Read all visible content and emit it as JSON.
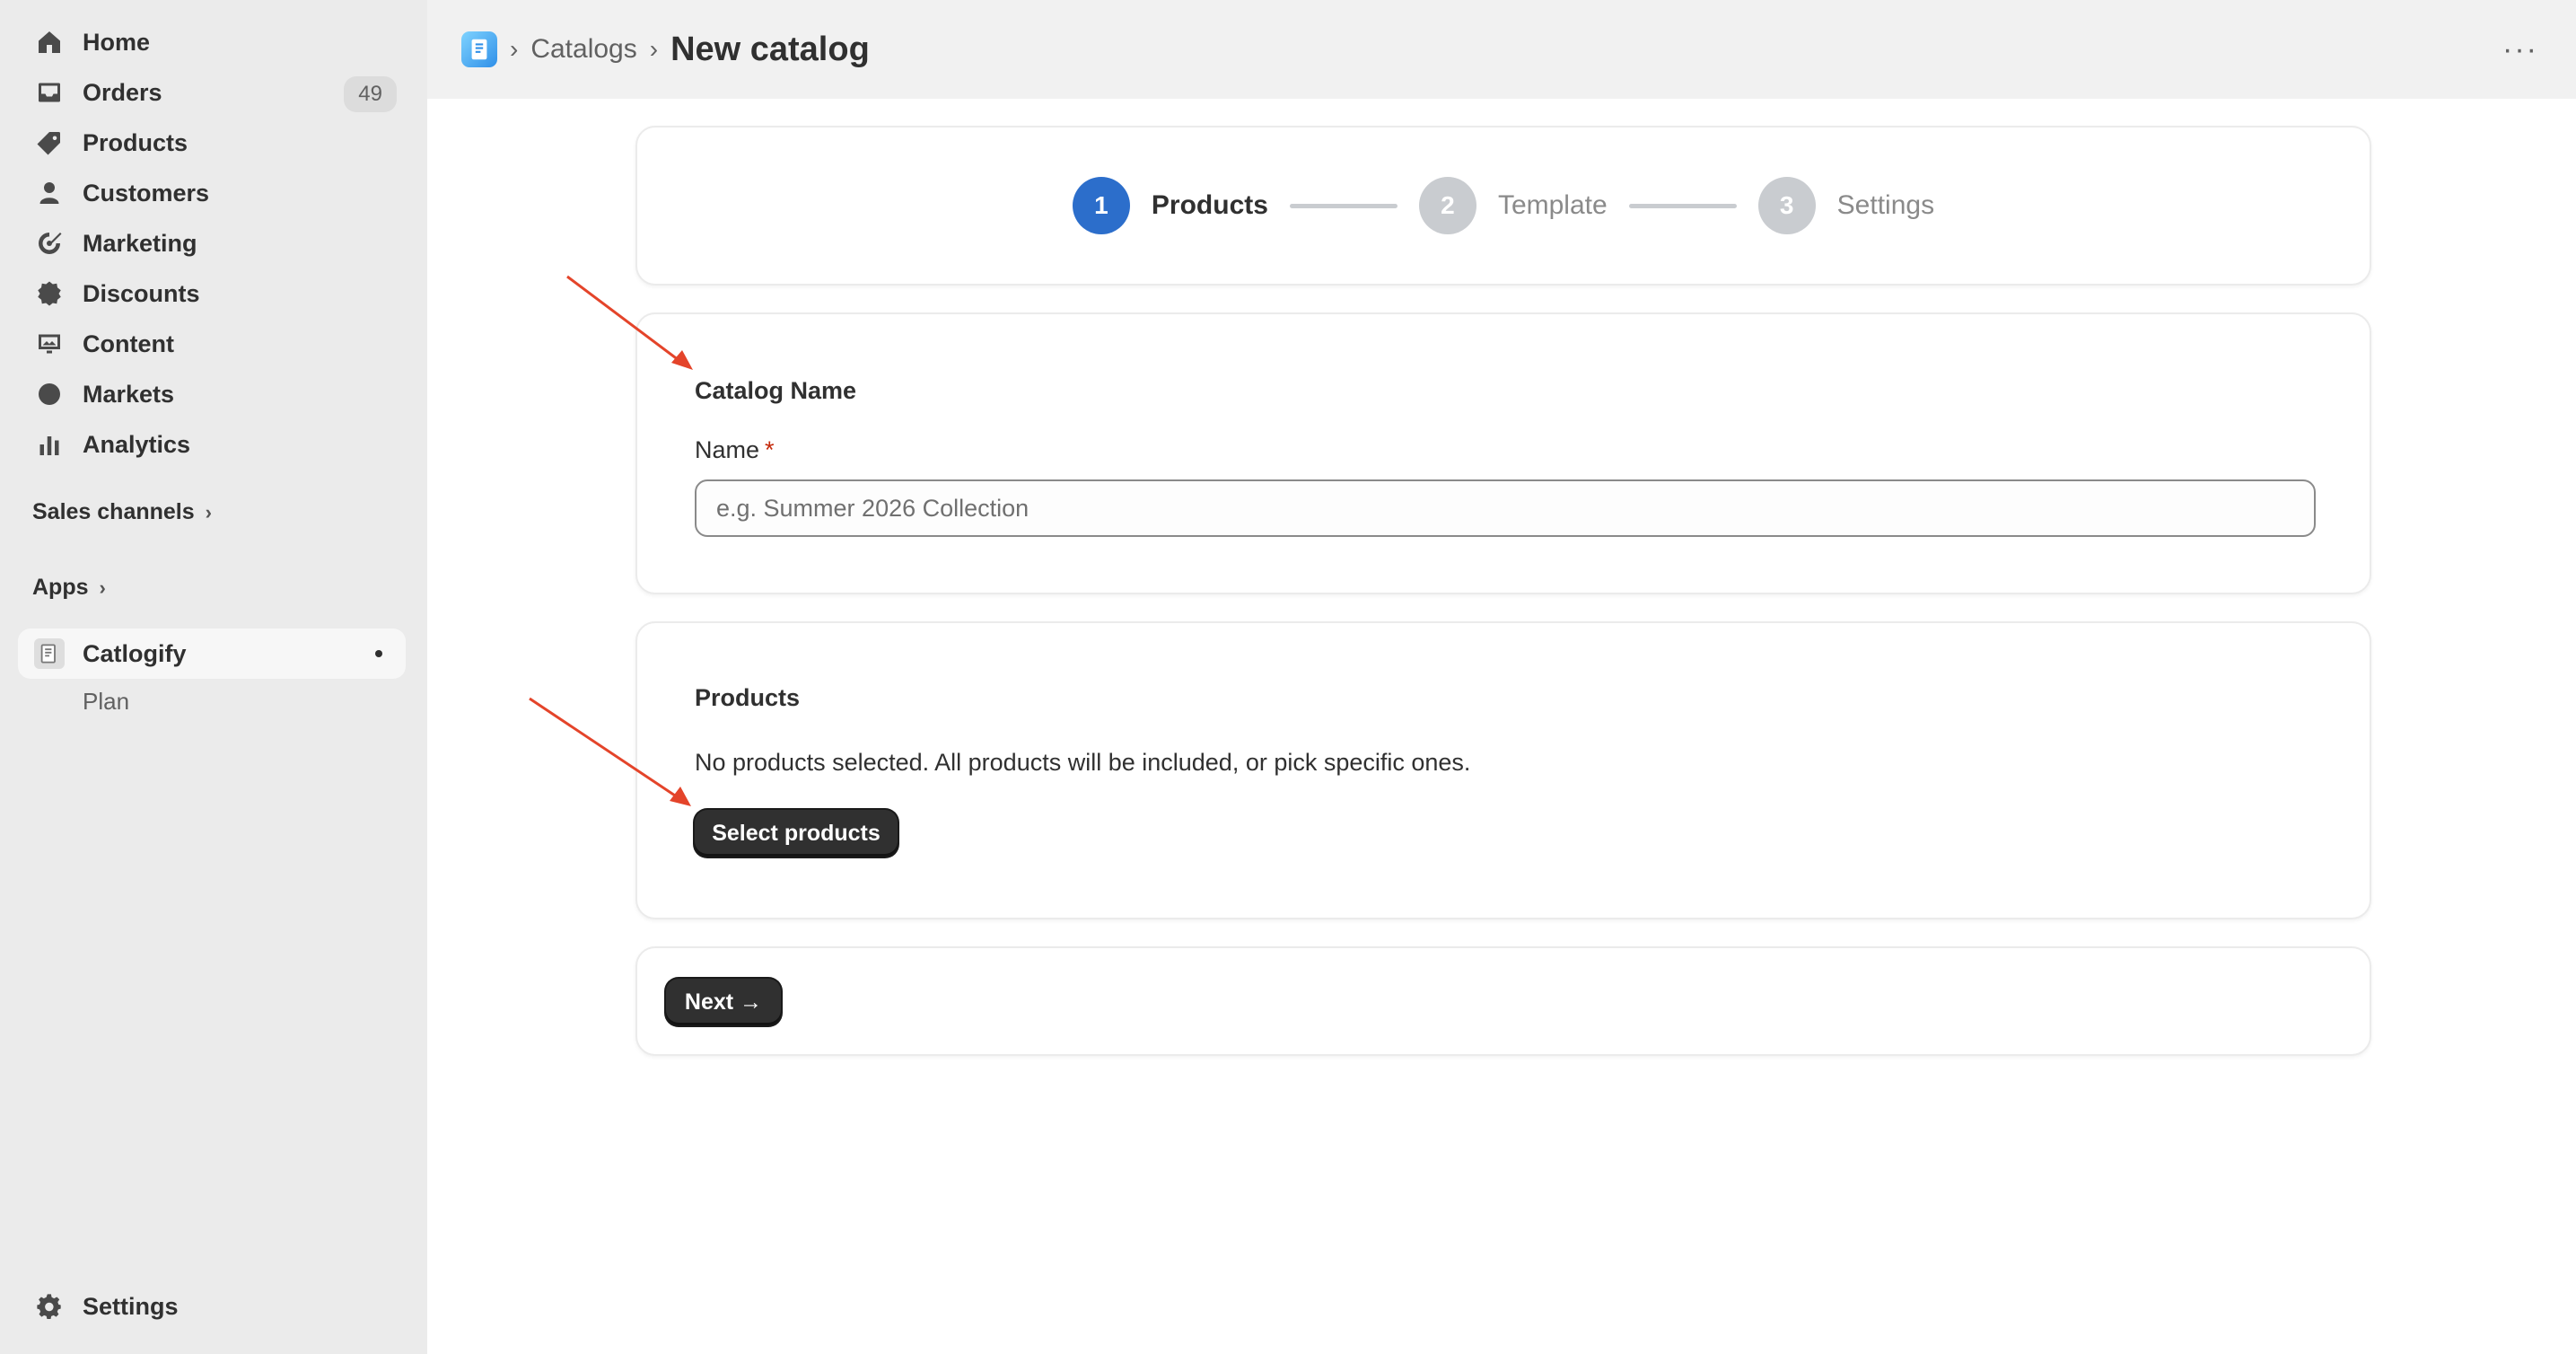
{
  "sidebar": {
    "items": [
      {
        "label": "Home",
        "icon": "home-icon"
      },
      {
        "label": "Orders",
        "icon": "inbox-icon",
        "badge": "49"
      },
      {
        "label": "Products",
        "icon": "tag-icon"
      },
      {
        "label": "Customers",
        "icon": "person-icon"
      },
      {
        "label": "Marketing",
        "icon": "target-icon"
      },
      {
        "label": "Discounts",
        "icon": "discount-icon"
      },
      {
        "label": "Content",
        "icon": "image-icon"
      },
      {
        "label": "Markets",
        "icon": "globe-icon"
      },
      {
        "label": "Analytics",
        "icon": "bar-chart-icon"
      }
    ],
    "sales_channels": "Sales channels",
    "apps": "Apps",
    "app_name": "Catlogify",
    "app_sub_item": "Plan",
    "settings": "Settings"
  },
  "header": {
    "breadcrumb_link": "Catalogs",
    "title": "New catalog",
    "separator": "›",
    "more": "···"
  },
  "stepper": {
    "steps": [
      {
        "number": "1",
        "label": "Products",
        "state": "active"
      },
      {
        "number": "2",
        "label": "Template",
        "state": "inactive"
      },
      {
        "number": "3",
        "label": "Settings",
        "state": "inactive"
      }
    ]
  },
  "catalog_name_card": {
    "title": "Catalog Name",
    "field_label": "Name",
    "required_mark": "*",
    "placeholder": "e.g. Summer 2026 Collection",
    "value": ""
  },
  "products_card": {
    "title": "Products",
    "description": "No products selected. All products will be included, or pick specific ones.",
    "button_label": "Select products"
  },
  "footer_card": {
    "next_label": "Next →"
  },
  "colors": {
    "accent": "#2c6ecb",
    "annotation_arrow": "#e4442a",
    "primary_button": "#303030"
  }
}
